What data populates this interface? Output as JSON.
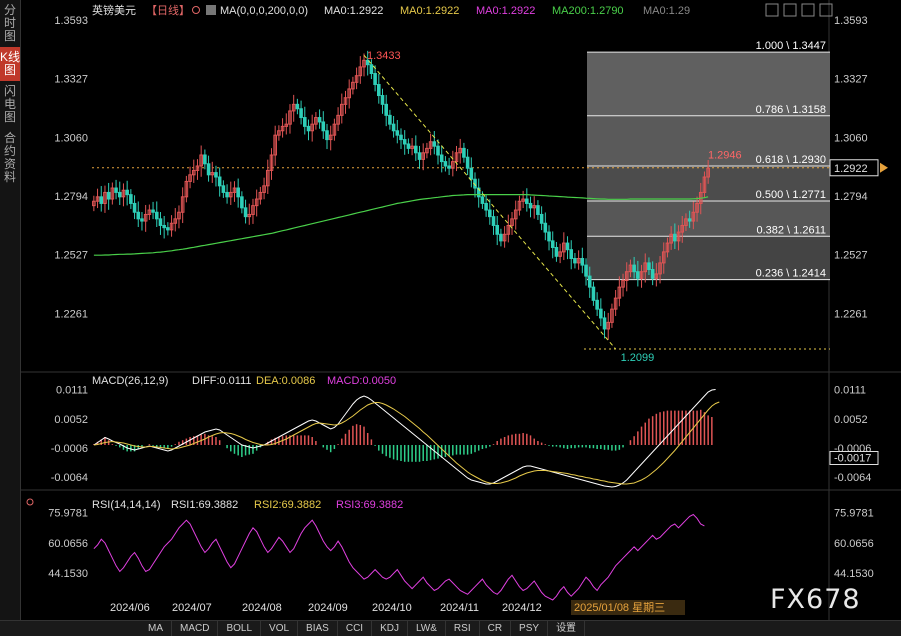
{
  "instrument": {
    "name": "英镑美元",
    "period": "【日线】"
  },
  "sidebar": {
    "tabs": [
      {
        "label": "分时图",
        "active": false
      },
      {
        "label": "K线图",
        "active": true
      },
      {
        "label": "闪电图",
        "active": false
      },
      {
        "label": "合约资料",
        "active": false
      }
    ]
  },
  "ma_header": {
    "params": "MA(0,0,0,200,0,0)",
    "items": [
      {
        "label": "MA0:1.2922",
        "color": "#e0e0e0"
      },
      {
        "label": "MA0:1.2922",
        "color": "#e6c94a"
      },
      {
        "label": "MA0:1.2922",
        "color": "#e040e0"
      },
      {
        "label": "MA200:1.2790",
        "color": "#4ad04a"
      },
      {
        "label": "MA0:1.29",
        "color": "#888888"
      }
    ]
  },
  "macd_header": {
    "title": "MACD(26,12,9)",
    "items": [
      {
        "label": "DIFF:0.0111",
        "color": "#e0e0e0"
      },
      {
        "label": "DEA:0.0086",
        "color": "#e6c94a"
      },
      {
        "label": "MACD:0.0050",
        "color": "#e040e0"
      }
    ]
  },
  "rsi_header": {
    "title": "RSI(14,14,14)",
    "items": [
      {
        "label": "RSI1:69.3882",
        "color": "#e0e0e0"
      },
      {
        "label": "RSI2:69.3882",
        "color": "#e6c94a"
      },
      {
        "label": "RSI3:69.3882",
        "color": "#e040e0"
      }
    ]
  },
  "chart_data": {
    "type": "candlestick",
    "price_axis": {
      "ticks": [
        "1.3593",
        "1.3327",
        "1.3060",
        "1.2794",
        "1.2527",
        "1.2261"
      ],
      "range": [
        1.2099,
        1.3593
      ]
    },
    "macd_axis": {
      "ticks": [
        "0.0111",
        "0.0052",
        "-0.0006",
        "-0.0064"
      ]
    },
    "rsi_axis": {
      "ticks": [
        "75.9781",
        "60.0656",
        "44.1530"
      ]
    },
    "x_axis": {
      "ticks": [
        "2024/06",
        "2024/07",
        "2024/08",
        "2024/09",
        "2024/10",
        "2024/11",
        "2024/12",
        "2025/01/08 星期三"
      ]
    },
    "current_price": "1.2922",
    "current_macd": "-0.0017",
    "annotations": {
      "high": "1.3433",
      "low": "1.2099",
      "last_high": "1.2946"
    },
    "fibonacci": [
      {
        "level": 1.0,
        "price": 1.3447,
        "label": "1.000 \\ 1.3447"
      },
      {
        "level": 0.786,
        "price": 1.3158,
        "label": "0.786 \\ 1.3158"
      },
      {
        "level": 0.618,
        "price": 1.293,
        "label": "0.618 \\ 1.2930"
      },
      {
        "level": 0.5,
        "price": 1.2771,
        "label": "0.500 \\ 1.2771"
      },
      {
        "level": 0.382,
        "price": 1.2611,
        "label": "0.382 \\ 1.2611"
      },
      {
        "level": 0.236,
        "price": 1.2414,
        "label": "0.236 \\ 1.2414"
      }
    ],
    "close": [
      1.277,
      1.279,
      1.276,
      1.281,
      1.278,
      1.283,
      1.281,
      1.279,
      1.282,
      1.28,
      1.276,
      1.272,
      1.269,
      1.268,
      1.271,
      1.273,
      1.272,
      1.269,
      1.266,
      1.265,
      1.264,
      1.267,
      1.269,
      1.272,
      1.279,
      1.286,
      1.289,
      1.291,
      1.293,
      1.298,
      1.294,
      1.289,
      1.29,
      1.288,
      1.284,
      1.281,
      1.279,
      1.281,
      1.283,
      1.279,
      1.274,
      1.27,
      1.271,
      1.275,
      1.278,
      1.281,
      1.284,
      1.291,
      1.298,
      1.307,
      1.309,
      1.311,
      1.312,
      1.318,
      1.321,
      1.319,
      1.315,
      1.311,
      1.309,
      1.312,
      1.315,
      1.313,
      1.309,
      1.305,
      1.307,
      1.312,
      1.316,
      1.321,
      1.324,
      1.328,
      1.331,
      1.334,
      1.338,
      1.341,
      1.339,
      1.335,
      1.33,
      1.325,
      1.321,
      1.316,
      1.312,
      1.309,
      1.307,
      1.305,
      1.303,
      1.301,
      1.302,
      1.299,
      1.296,
      1.299,
      1.301,
      1.304,
      1.302,
      1.298,
      1.295,
      1.293,
      1.292,
      1.295,
      1.299,
      1.301,
      1.297,
      1.292,
      1.287,
      1.283,
      1.279,
      1.276,
      1.273,
      1.27,
      1.266,
      1.262,
      1.259,
      1.262,
      1.266,
      1.269,
      1.273,
      1.277,
      1.278,
      1.276,
      1.274,
      1.275,
      1.271,
      1.267,
      1.263,
      1.259,
      1.256,
      1.252,
      1.254,
      1.258,
      1.255,
      1.251,
      1.249,
      1.251,
      1.248,
      1.243,
      1.238,
      1.232,
      1.228,
      1.224,
      1.219,
      1.222,
      1.228,
      1.233,
      1.238,
      1.241,
      1.245,
      1.248,
      1.245,
      1.242,
      1.245,
      1.249,
      1.246,
      1.242,
      1.244,
      1.249,
      1.254,
      1.258,
      1.262,
      1.259,
      1.263,
      1.266,
      1.269,
      1.268,
      1.272,
      1.276,
      1.281,
      1.288,
      1.292
    ],
    "ma200": [
      1.2525,
      1.2525,
      1.2525,
      1.2526,
      1.2526,
      1.2527,
      1.2528,
      1.2529,
      1.2529,
      1.253,
      1.253,
      1.2531,
      1.2532,
      1.2533,
      1.2534,
      1.2535,
      1.2536,
      1.2538,
      1.2539,
      1.2541,
      1.2543,
      1.2545,
      1.2548,
      1.255,
      1.2552,
      1.2555,
      1.2558,
      1.2561,
      1.2564,
      1.2567,
      1.257,
      1.2573,
      1.2576,
      1.2579,
      1.2582,
      1.2585,
      1.2588,
      1.2591,
      1.2594,
      1.2597,
      1.26,
      1.2603,
      1.2606,
      1.2609,
      1.2612,
      1.2615,
      1.2618,
      1.2621,
      1.2624,
      1.2628,
      1.2632,
      1.2636,
      1.264,
      1.2644,
      1.2648,
      1.2652,
      1.2656,
      1.266,
      1.2664,
      1.2668,
      1.2672,
      1.2676,
      1.268,
      1.2684,
      1.2688,
      1.2692,
      1.2696,
      1.27,
      1.2704,
      1.2708,
      1.2712,
      1.2716,
      1.272,
      1.2724,
      1.2728,
      1.2732,
      1.2736,
      1.274,
      1.2744,
      1.2748,
      1.2752,
      1.2756,
      1.276,
      1.2763,
      1.2766,
      1.2769,
      1.2772,
      1.2775,
      1.2778,
      1.278,
      1.2782,
      1.2784,
      1.2786,
      1.2788,
      1.279,
      1.2792,
      1.2794,
      1.2796,
      1.2797,
      1.2798,
      1.2799,
      1.28,
      1.28,
      1.28,
      1.28,
      1.28,
      1.28,
      1.28,
      1.28,
      1.28,
      1.28,
      1.28,
      1.28,
      1.28,
      1.28,
      1.28,
      1.28,
      1.28,
      1.2799,
      1.2798,
      1.2797,
      1.2796,
      1.2795,
      1.2794,
      1.2793,
      1.2792,
      1.2791,
      1.279,
      1.2789,
      1.2788,
      1.2787,
      1.2786,
      1.2785,
      1.2784,
      1.2783,
      1.2782,
      1.2781,
      1.278,
      1.278,
      1.2779,
      1.2779,
      1.2779,
      1.2779,
      1.2779,
      1.2779,
      1.278,
      1.278,
      1.278,
      1.278,
      1.278,
      1.278,
      1.278,
      1.278,
      1.278,
      1.278,
      1.278,
      1.278,
      1.278,
      1.278,
      1.278,
      1.278,
      1.278,
      1.2781,
      1.2782,
      1.2784,
      1.2786,
      1.279
    ],
    "macd_diff": [
      0.0,
      0.0005,
      0.001,
      0.0015,
      0.0012,
      0.0008,
      0.0005,
      0.0002,
      -0.0002,
      -0.0006,
      -0.0008,
      -0.001,
      -0.0008,
      -0.0006,
      -0.0004,
      -0.0002,
      -0.0004,
      -0.0006,
      -0.0008,
      -0.001,
      -0.0012,
      -0.001,
      -0.0006,
      -0.0002,
      0.0002,
      0.0006,
      0.001,
      0.0014,
      0.0018,
      0.0022,
      0.0026,
      0.0028,
      0.003,
      0.0032,
      0.003,
      0.0025,
      0.002,
      0.0015,
      0.001,
      0.0005,
      0.0,
      -0.0002,
      -0.0004,
      -0.0006,
      -0.0004,
      -0.0002,
      0.0,
      0.0004,
      0.0008,
      0.0012,
      0.0016,
      0.002,
      0.0024,
      0.0028,
      0.0032,
      0.0036,
      0.004,
      0.0044,
      0.0048,
      0.005,
      0.0048,
      0.0044,
      0.004,
      0.0036,
      0.0032,
      0.0035,
      0.0042,
      0.0052,
      0.0062,
      0.0072,
      0.0082,
      0.009,
      0.0095,
      0.0098,
      0.0095,
      0.009,
      0.0084,
      0.0078,
      0.0072,
      0.0066,
      0.006,
      0.0054,
      0.0048,
      0.0042,
      0.0036,
      0.003,
      0.0024,
      0.0018,
      0.0012,
      0.0006,
      0.0,
      -0.0006,
      -0.0012,
      -0.0018,
      -0.0024,
      -0.003,
      -0.0036,
      -0.0042,
      -0.0048,
      -0.0054,
      -0.006,
      -0.0066,
      -0.007,
      -0.0072,
      -0.0074,
      -0.0076,
      -0.0078,
      -0.0078,
      -0.0076,
      -0.0072,
      -0.0068,
      -0.0064,
      -0.006,
      -0.0056,
      -0.0052,
      -0.0048,
      -0.0044,
      -0.0042,
      -0.0042,
      -0.0044,
      -0.0046,
      -0.0048,
      -0.005,
      -0.0052,
      -0.0054,
      -0.0056,
      -0.0058,
      -0.006,
      -0.0062,
      -0.0064,
      -0.0066,
      -0.0068,
      -0.007,
      -0.0072,
      -0.0074,
      -0.0076,
      -0.0078,
      -0.008,
      -0.0082,
      -0.0083,
      -0.0084,
      -0.0083,
      -0.008,
      -0.0076,
      -0.007,
      -0.0062,
      -0.0054,
      -0.0046,
      -0.0038,
      -0.003,
      -0.0022,
      -0.0014,
      -0.0006,
      0.0002,
      0.001,
      0.0018,
      0.0026,
      0.0034,
      0.0042,
      0.005,
      0.0058,
      0.0066,
      0.0074,
      0.0082,
      0.009,
      0.0098,
      0.0106,
      0.011,
      0.0111
    ],
    "macd_dea": [
      0.0,
      0.0001,
      0.0003,
      0.0005,
      0.0006,
      0.0007,
      0.0006,
      0.0005,
      0.0004,
      0.0002,
      0.0,
      -0.0002,
      -0.0003,
      -0.0004,
      -0.0004,
      -0.0003,
      -0.0003,
      -0.0004,
      -0.0005,
      -0.0006,
      -0.0007,
      -0.0008,
      -0.0007,
      -0.0006,
      -0.0004,
      -0.0002,
      0.0,
      0.0003,
      0.0006,
      0.0009,
      0.0012,
      0.0016,
      0.0019,
      0.0022,
      0.0024,
      0.0025,
      0.0024,
      0.0023,
      0.0021,
      0.0018,
      0.0015,
      0.0011,
      0.0008,
      0.0005,
      0.0003,
      0.0001,
      0.0,
      0.0,
      0.0001,
      0.0003,
      0.0006,
      0.0009,
      0.0012,
      0.0016,
      0.002,
      0.0024,
      0.0028,
      0.0032,
      0.0036,
      0.004,
      0.0043,
      0.0044,
      0.0043,
      0.0042,
      0.0041,
      0.004,
      0.0041,
      0.0044,
      0.0048,
      0.0053,
      0.0058,
      0.0064,
      0.007,
      0.0075,
      0.008,
      0.0083,
      0.0085,
      0.0085,
      0.0083,
      0.008,
      0.0076,
      0.0072,
      0.0067,
      0.0062,
      0.0057,
      0.0051,
      0.0045,
      0.0039,
      0.0033,
      0.0026,
      0.002,
      0.0013,
      0.0006,
      -0.0001,
      -0.0008,
      -0.0015,
      -0.0022,
      -0.0029,
      -0.0036,
      -0.0042,
      -0.0048,
      -0.0054,
      -0.0059,
      -0.0063,
      -0.0067,
      -0.0071,
      -0.0074,
      -0.0076,
      -0.0077,
      -0.0077,
      -0.0076,
      -0.0074,
      -0.0072,
      -0.0069,
      -0.0066,
      -0.0062,
      -0.0059,
      -0.0056,
      -0.0054,
      -0.0052,
      -0.0051,
      -0.0051,
      -0.0051,
      -0.0052,
      -0.0053,
      -0.0054,
      -0.0055,
      -0.0056,
      -0.0057,
      -0.0059,
      -0.006,
      -0.0062,
      -0.0063,
      -0.0065,
      -0.0066,
      -0.0068,
      -0.0069,
      -0.0071,
      -0.0072,
      -0.0074,
      -0.0075,
      -0.0076,
      -0.0077,
      -0.0078,
      -0.0078,
      -0.0077,
      -0.0076,
      -0.0073,
      -0.007,
      -0.0066,
      -0.0061,
      -0.0055,
      -0.0049,
      -0.0042,
      -0.0035,
      -0.0027,
      -0.0019,
      -0.0011,
      -0.0002,
      0.0007,
      0.0016,
      0.0025,
      0.0034,
      0.0043,
      0.0052,
      0.0061,
      0.007,
      0.0078,
      0.0083,
      0.0086
    ],
    "rsi": [
      57,
      59,
      62,
      60,
      56,
      52,
      48,
      45,
      47,
      50,
      53,
      55,
      52,
      48,
      45,
      46,
      49,
      52,
      55,
      58,
      60,
      62,
      65,
      68,
      70,
      72,
      70,
      66,
      62,
      58,
      55,
      57,
      60,
      62,
      58,
      54,
      50,
      47,
      49,
      53,
      57,
      61,
      65,
      68,
      66,
      62,
      58,
      55,
      57,
      60,
      63,
      61,
      58,
      55,
      57,
      61,
      65,
      68,
      70,
      72,
      69,
      65,
      61,
      58,
      56,
      58,
      61,
      58,
      54,
      50,
      47,
      45,
      43,
      41,
      42,
      44,
      46,
      44,
      42,
      41,
      42,
      44,
      46,
      43,
      40,
      38,
      36,
      38,
      40,
      42,
      39,
      37,
      35,
      36,
      38,
      40,
      41,
      39,
      37,
      35,
      34,
      33,
      35,
      37,
      39,
      41,
      38,
      36,
      34,
      33,
      35,
      38,
      41,
      43,
      40,
      37,
      35,
      36,
      38,
      40,
      37,
      34,
      32,
      31,
      30,
      32,
      35,
      37,
      34,
      32,
      34,
      36,
      39,
      42,
      40,
      37,
      35,
      38,
      40,
      42,
      45,
      48,
      50,
      52,
      54,
      56,
      58,
      56,
      58,
      60,
      62,
      64,
      62,
      63,
      65,
      67,
      69,
      70,
      68,
      70,
      72,
      74,
      75,
      73,
      70,
      69
    ],
    "macd_hist": [
      0.0001,
      0.0004,
      0.0007,
      0.001,
      0.0006,
      0.0001,
      -0.0001,
      -0.0003,
      -0.0006,
      -0.0008,
      -0.0008,
      -0.0008,
      -0.0005,
      -0.0002,
      0.0,
      0.0001,
      -0.0001,
      -0.0002,
      -0.0003,
      -0.0004,
      -0.0005,
      -0.0002,
      0.0001,
      0.0004,
      0.0006,
      0.0008,
      0.001,
      0.0011,
      0.0012,
      0.0013,
      0.0014,
      0.0012,
      0.0011,
      0.001,
      0.0006,
      0.0,
      -0.0004,
      -0.0008,
      -0.0011,
      -0.0013,
      -0.0015,
      -0.0013,
      -0.0012,
      -0.0011,
      -0.0007,
      -0.0003,
      0.0,
      0.0004,
      0.0007,
      0.0009,
      0.001,
      0.0011,
      0.0012,
      0.0012,
      0.0012,
      0.0012,
      0.0012,
      0.0012,
      0.0012,
      0.001,
      0.0005,
      0.0,
      -0.0003,
      -0.0006,
      -0.0009,
      -0.0005,
      0.0001,
      0.0008,
      0.0014,
      0.0019,
      0.0024,
      0.0026,
      0.0025,
      0.0023,
      0.0015,
      0.0007,
      -0.0001,
      -0.0007,
      -0.0011,
      -0.0014,
      -0.0016,
      -0.0018,
      -0.0019,
      -0.002,
      -0.0021,
      -0.0021,
      -0.0021,
      -0.0021,
      -0.0021,
      -0.002,
      -0.002,
      -0.0019,
      -0.0018,
      -0.0017,
      -0.0016,
      -0.0015,
      -0.0014,
      -0.0013,
      -0.0012,
      -0.0012,
      -0.0012,
      -0.0012,
      -0.0011,
      -0.0009,
      -0.0007,
      -0.0005,
      -0.0004,
      -0.0002,
      0.0001,
      0.0005,
      0.0008,
      0.001,
      0.0012,
      0.0013,
      0.0014,
      0.0014,
      0.0015,
      0.0014,
      0.0012,
      0.0008,
      0.0005,
      0.0003,
      0.0001,
      -0.0001,
      -0.0002,
      -0.0002,
      -0.0003,
      -0.0004,
      -0.0005,
      -0.0004,
      -0.0004,
      -0.0003,
      -0.0003,
      -0.0003,
      -0.0004,
      -0.0004,
      -0.0005,
      -0.0005,
      -0.0006,
      -0.0006,
      -0.0007,
      -0.0007,
      -0.0006,
      -0.0003,
      0.0,
      0.0006,
      0.0011,
      0.0017,
      0.0023,
      0.0028,
      0.0033,
      0.0036,
      0.0039,
      0.0041,
      0.0042,
      0.0043,
      0.0043,
      0.0043,
      0.0043,
      0.0043,
      0.0043,
      0.0043,
      0.0043,
      0.0043,
      0.0044,
      0.0041,
      0.0037,
      0.0035
    ]
  },
  "bottom_tabs": [
    "MA",
    "MACD",
    "BOLL",
    "VOL",
    "BIAS",
    "CCI",
    "KDJ",
    "LW&",
    "RSI",
    "CR",
    "PSY",
    "设置"
  ],
  "toolbar_icons": [
    "gear-icon",
    "home-icon",
    "prev-icon",
    "next-icon",
    "close-icon"
  ],
  "watermark": "FX678"
}
